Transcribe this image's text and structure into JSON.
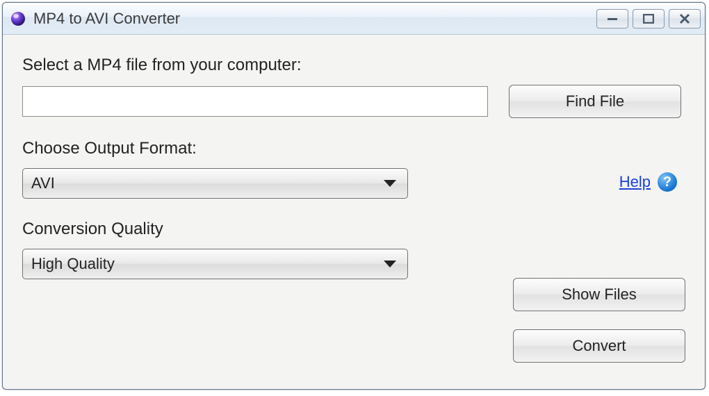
{
  "window": {
    "title": "MP4 to AVI Converter"
  },
  "labels": {
    "select_file": "Select a MP4 file from your computer:",
    "choose_format": "Choose Output Format:",
    "conversion_quality": "Conversion Quality"
  },
  "inputs": {
    "file_path": ""
  },
  "dropdowns": {
    "format_selected": "AVI",
    "quality_selected": "High Quality"
  },
  "buttons": {
    "find_file": "Find File",
    "show_files": "Show Files",
    "convert": "Convert"
  },
  "help": {
    "link": "Help",
    "icon": "?"
  }
}
